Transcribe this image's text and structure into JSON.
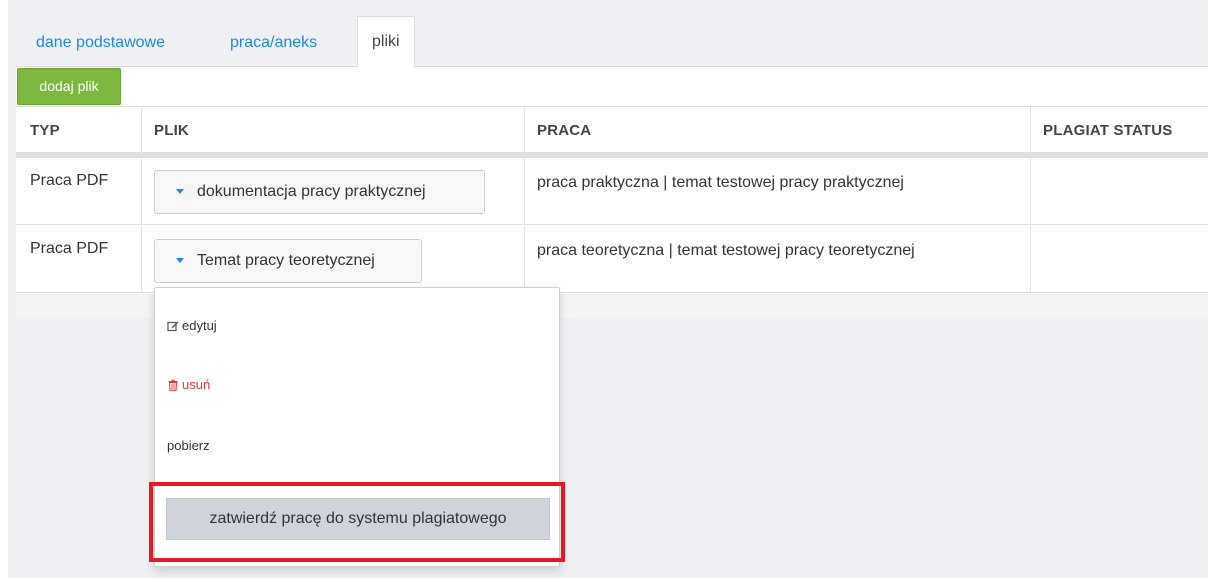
{
  "tabs": [
    {
      "label": "dane podstawowe",
      "active": false
    },
    {
      "label": "praca/aneks",
      "active": false
    },
    {
      "label": "pliki",
      "active": true
    }
  ],
  "toolbar": {
    "add_file_label": "dodaj plik"
  },
  "table": {
    "headers": [
      "TYP",
      "PLIK",
      "PRACA",
      "PLAGIAT STATUS"
    ],
    "rows": [
      {
        "typ": "Praca PDF",
        "plik": "dokumentacja pracy praktycznej",
        "praca": "praca praktyczna | temat testowej pracy praktycznej",
        "plagiat_status": ""
      },
      {
        "typ": "Praca PDF",
        "plik": "Temat pracy teoretycznej",
        "praca": "praca teoretyczna | temat testowej pracy teoretycznej",
        "plagiat_status": ""
      }
    ]
  },
  "dropdown": {
    "edit_label": "edytuj",
    "delete_label": "usuń",
    "download_label": "pobierz",
    "approve_label": "zatwierdź pracę do systemu plagiatowego"
  },
  "colors": {
    "accent": "#1e88e5",
    "success_button": "#7cb83e",
    "danger": "#e53935",
    "highlight_frame": "#e21b23"
  },
  "icons": {
    "edit": "edit-icon",
    "delete": "trash-icon",
    "caret": "caret-down-icon"
  }
}
